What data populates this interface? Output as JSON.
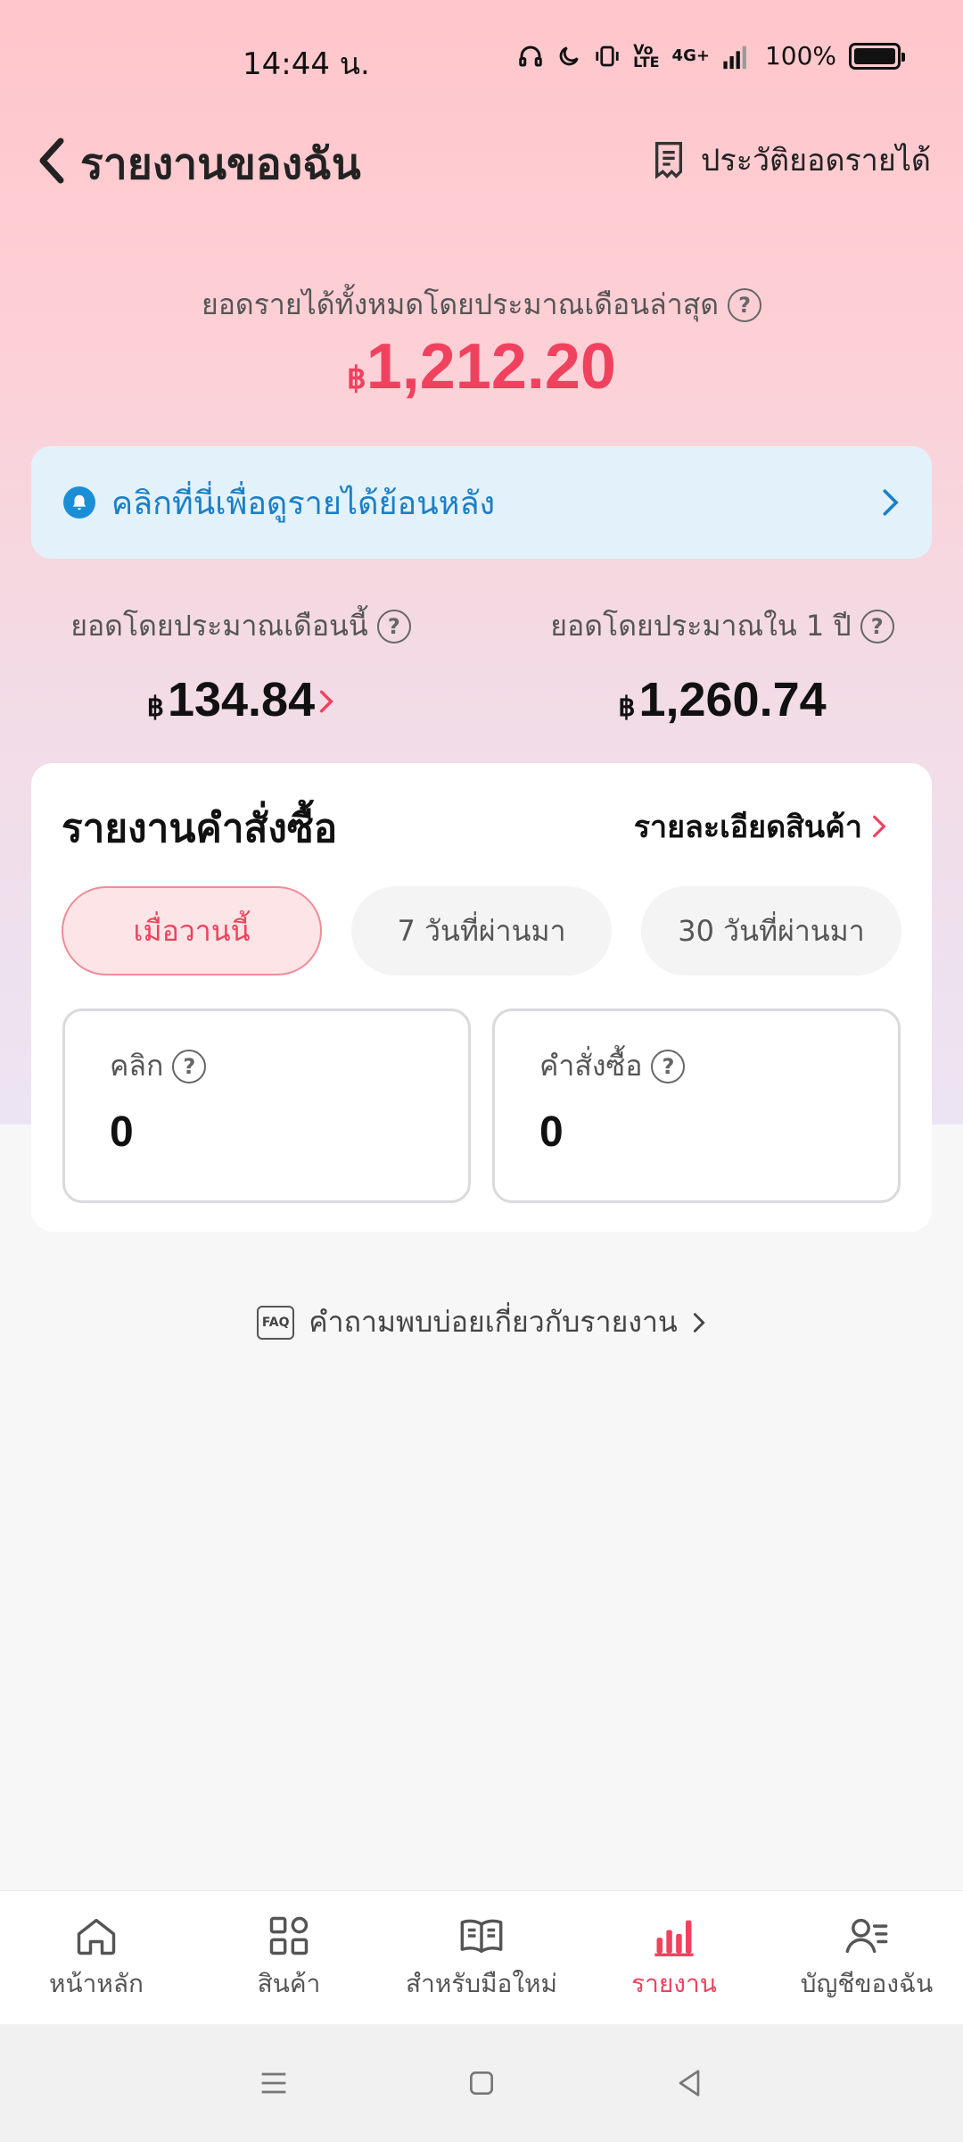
{
  "status": {
    "time": "14:44 น.",
    "battery": "100%",
    "network": "4G+"
  },
  "header": {
    "title": "รายงานของฉัน",
    "history_label": "ประวัติยอดรายได้"
  },
  "total": {
    "label": "ยอดรายได้ทั้งหมดโดยประมาณเดือนล่าสุด",
    "currency": "฿",
    "amount": "1,212.20"
  },
  "banner": {
    "text": "คลิกที่นี่เพื่อดูรายได้ย้อนหลัง"
  },
  "estimates": {
    "month": {
      "label": "ยอดโดยประมาณเดือนนี้",
      "currency": "฿",
      "amount": "134.84"
    },
    "year": {
      "label": "ยอดโดยประมาณใน 1 ปี",
      "currency": "฿",
      "amount": "1,260.74"
    }
  },
  "orders": {
    "title": "รายงานคำสั่งซื้อ",
    "detail_link": "รายละเอียดสินค้า",
    "ranges": [
      "เมื่อวานนี้",
      "7 วันที่ผ่านมา",
      "30 วันที่ผ่านมา"
    ],
    "active_range": 0,
    "metrics": [
      {
        "label": "คลิก",
        "value": "0"
      },
      {
        "label": "คำสั่งซื้อ",
        "value": "0"
      }
    ]
  },
  "faq": {
    "badge": "FAQ",
    "text": "คำถามพบบ่อยเกี่ยวกับรายงาน"
  },
  "nav": [
    {
      "label": "หน้าหลัก",
      "icon": "home-icon"
    },
    {
      "label": "สินค้า",
      "icon": "grid-icon"
    },
    {
      "label": "สำหรับมือใหม่",
      "icon": "book-icon"
    },
    {
      "label": "รายงาน",
      "icon": "bar-chart-icon"
    },
    {
      "label": "บัญชีของฉัน",
      "icon": "account-icon"
    }
  ],
  "nav_active": 3,
  "colors": {
    "accent": "#f0425e",
    "banner_text": "#1a7fc6",
    "banner_bg": "#e3f1fb"
  }
}
